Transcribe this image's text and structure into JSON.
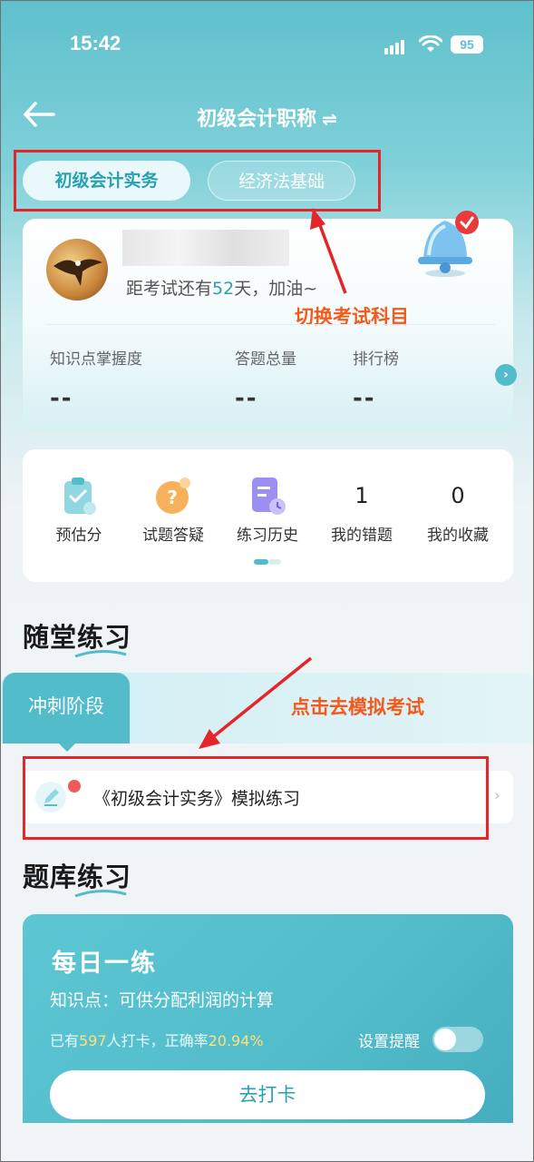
{
  "status": {
    "time": "15:42",
    "battery": "95"
  },
  "nav": {
    "title": "初级会计职称"
  },
  "subject_tabs": [
    {
      "label": "初级会计实务",
      "active": true
    },
    {
      "label": "经济法基础",
      "active": false
    }
  ],
  "profile": {
    "countdown_prefix": "距考试还有",
    "countdown_days": "52",
    "countdown_suffix": "天，加油~",
    "stats": [
      {
        "label": "知识点掌握度",
        "value": "--"
      },
      {
        "label": "答题总量",
        "value": "--"
      },
      {
        "label": "排行榜",
        "value": "--"
      }
    ]
  },
  "annotations": {
    "switch_subject": "切换考试科目",
    "go_mock": "点击去模拟考试"
  },
  "shortcuts": [
    {
      "label": "预估分",
      "icon": "clipboard-chart-icon"
    },
    {
      "label": "试题答疑",
      "icon": "question-bubble-icon"
    },
    {
      "label": "练习历史",
      "icon": "document-clock-icon"
    },
    {
      "label": "我的错题",
      "count": "1"
    },
    {
      "label": "我的收藏",
      "count": "0"
    }
  ],
  "sections": {
    "classroom": "随堂练习",
    "bank": "题库练习"
  },
  "sprint": {
    "tab": "冲刺阶段",
    "item": "《初级会计实务》模拟练习"
  },
  "daily": {
    "title": "每日一练",
    "knowledge_point": "知识点：可供分配利润的计算",
    "stats_prefix": "已有",
    "checkin_count": "597",
    "stats_mid": "人打卡，正确率",
    "accuracy": "20.94%",
    "remind_label": "设置提醒",
    "remind_on": false,
    "button": "去打卡"
  },
  "colors": {
    "accent": "#52bccb",
    "annotation_red": "#e4262a",
    "annotation_orange": "#f25a1d"
  }
}
